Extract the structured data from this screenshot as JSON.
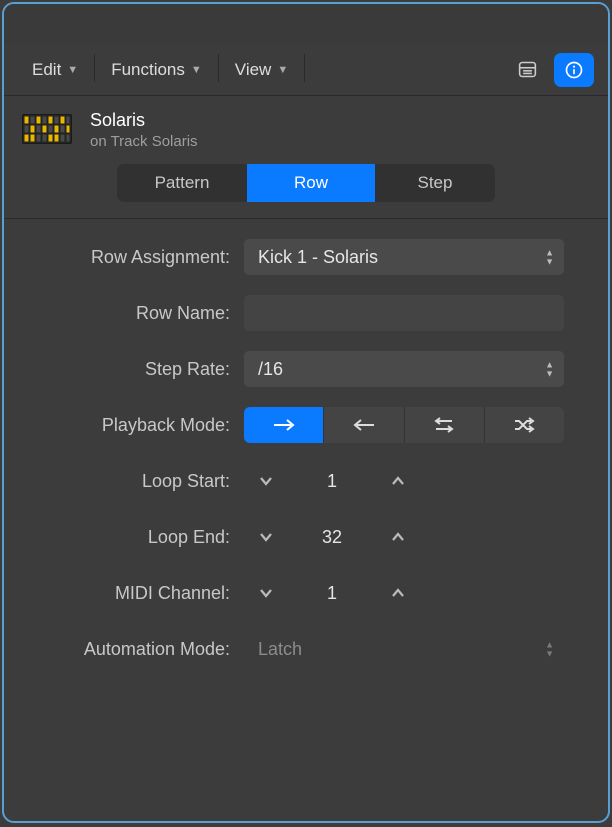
{
  "toolbar": {
    "edit_label": "Edit",
    "functions_label": "Functions",
    "view_label": "View"
  },
  "header": {
    "title": "Solaris",
    "subtitle": "on Track Solaris"
  },
  "tabs": {
    "pattern": "Pattern",
    "row": "Row",
    "step": "Step"
  },
  "form": {
    "row_assignment": {
      "label": "Row Assignment:",
      "value": "Kick 1 - Solaris"
    },
    "row_name": {
      "label": "Row Name:",
      "value": ""
    },
    "step_rate": {
      "label": "Step Rate:",
      "value": "/16"
    },
    "playback_mode": {
      "label": "Playback Mode:"
    },
    "loop_start": {
      "label": "Loop Start:",
      "value": "1"
    },
    "loop_end": {
      "label": "Loop End:",
      "value": "32"
    },
    "midi_channel": {
      "label": "MIDI Channel:",
      "value": "1"
    },
    "automation_mode": {
      "label": "Automation Mode:",
      "value": "Latch"
    }
  }
}
